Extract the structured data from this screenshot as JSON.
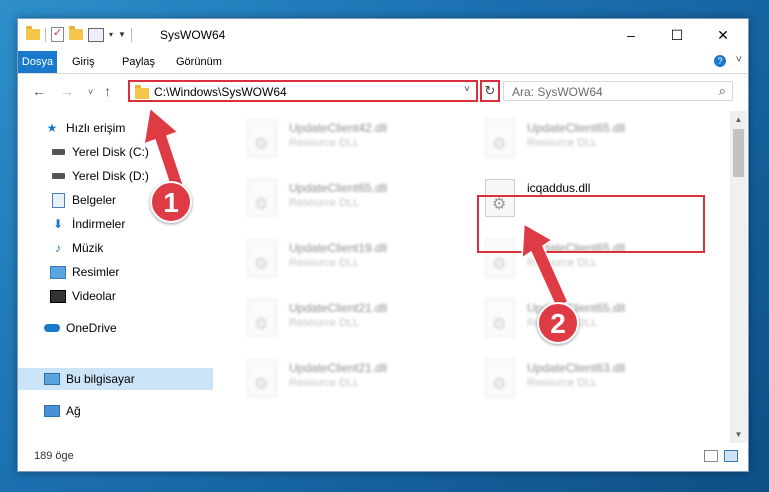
{
  "window": {
    "title": "SysWOW64"
  },
  "ribbon": {
    "tabs": [
      "Dosya",
      "Giriş",
      "Paylaş",
      "Görünüm"
    ]
  },
  "address": {
    "path": "C:\\Windows\\SysWOW64"
  },
  "search": {
    "placeholder": "Ara: SysWOW64"
  },
  "nav": {
    "items": [
      {
        "label": "Hızlı erişim"
      },
      {
        "label": "Yerel Disk (C:)"
      },
      {
        "label": "Yerel Disk (D:)"
      },
      {
        "label": "Belgeler"
      },
      {
        "label": "İndirmeler"
      },
      {
        "label": "Müzik"
      },
      {
        "label": "Resimler"
      },
      {
        "label": "Videolar"
      },
      {
        "label": "OneDrive"
      },
      {
        "label": "Bu bilgisayar"
      },
      {
        "label": "Ağ"
      }
    ]
  },
  "files": [
    {
      "name": "UpdateClient42.dll",
      "type": "Resource DLL"
    },
    {
      "name": "UpdateClient65.dll",
      "type": "Resource DLL"
    },
    {
      "name": "UpdateClient65.dll",
      "type": "Resource DLL"
    },
    {
      "name": "icqaddus.dll",
      "type": ""
    },
    {
      "name": "UpdateClient19.dll",
      "type": "Resource DLL"
    },
    {
      "name": "UpdateClient65.dll",
      "type": "Resource DLL"
    },
    {
      "name": "UpdateClient21.dll",
      "type": "Resource DLL"
    },
    {
      "name": "UpdateClient65.dll",
      "type": "Resource DLL"
    },
    {
      "name": "UpdateClient21.dll",
      "type": "Resource DLL"
    },
    {
      "name": "UpdateClient63.dll",
      "type": "Resource DLL"
    }
  ],
  "status": {
    "count": "189 öge"
  },
  "annotations": {
    "step1": "1",
    "step2": "2"
  },
  "colors": {
    "accent": "#1979ca",
    "highlight": "#d9303b",
    "badge": "#df3b45"
  }
}
